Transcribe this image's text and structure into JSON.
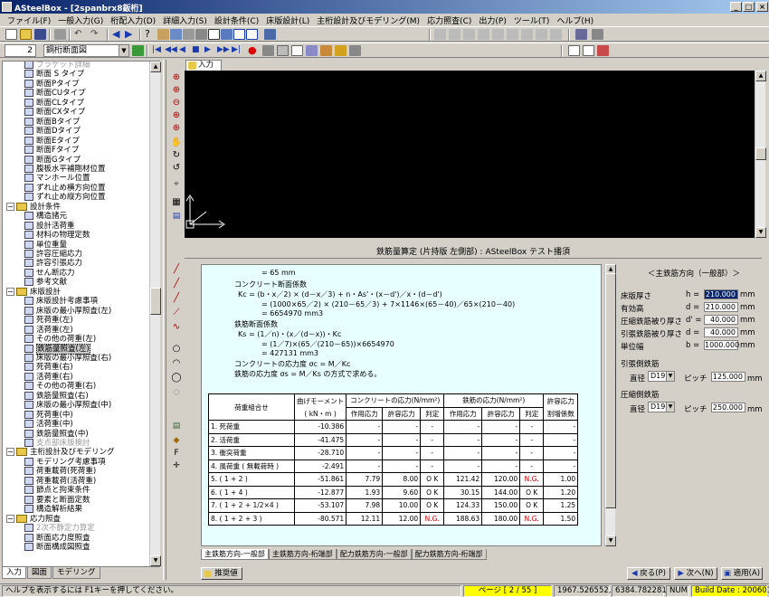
{
  "window": {
    "title": "ASteelBox - [2spanbrx8鈑桁]"
  },
  "menu": [
    "ファイル(F)",
    "一般入力(G)",
    "桁配入力(D)",
    "詳細入力(S)",
    "設計条件(C)",
    "床版設計(L)",
    "主桁設計及びモデリング(M)",
    "応力照査(C)",
    "出力(P)",
    "ツール(T)",
    "ヘルプ(H)"
  ],
  "toolbar2": {
    "number": "2",
    "combo": "鋼桁断面図"
  },
  "tree": [
    {
      "t": "ブラケット詳細",
      "lvl": 2,
      "k": "ic",
      "gray": true
    },
    {
      "t": "断面 S タイプ",
      "lvl": 2,
      "k": "ic"
    },
    {
      "t": "断面Pタイプ",
      "lvl": 2,
      "k": "ic"
    },
    {
      "t": "断面CUタイプ",
      "lvl": 2,
      "k": "ic"
    },
    {
      "t": "断面CLタイプ",
      "lvl": 2,
      "k": "ic"
    },
    {
      "t": "断面CXタイプ",
      "lvl": 2,
      "k": "ic"
    },
    {
      "t": "断面Bタイプ",
      "lvl": 2,
      "k": "ic"
    },
    {
      "t": "断面Dタイプ",
      "lvl": 2,
      "k": "ic"
    },
    {
      "t": "断面Eタイプ",
      "lvl": 2,
      "k": "ic"
    },
    {
      "t": "断面Fタイプ",
      "lvl": 2,
      "k": "ic"
    },
    {
      "t": "断面Gタイプ",
      "lvl": 2,
      "k": "ic"
    },
    {
      "t": "腹板水平補剛材位置",
      "lvl": 2,
      "k": "ic"
    },
    {
      "t": "マンホール位置",
      "lvl": 2,
      "k": "ic"
    },
    {
      "t": "ずれ止め横方向位置",
      "lvl": 2,
      "k": "ic"
    },
    {
      "t": "ずれ止め縦方向位置",
      "lvl": 2,
      "k": "ic"
    },
    {
      "t": "設計条件",
      "lvl": 0,
      "k": "fold"
    },
    {
      "t": "構造諸元",
      "lvl": 1,
      "k": "ic"
    },
    {
      "t": "設計活荷重",
      "lvl": 1,
      "k": "ic"
    },
    {
      "t": "材料の物理定数",
      "lvl": 1,
      "k": "ic"
    },
    {
      "t": "単位重量",
      "lvl": 1,
      "k": "ic"
    },
    {
      "t": "許容圧縮応力",
      "lvl": 1,
      "k": "ic"
    },
    {
      "t": "許容引張応力",
      "lvl": 1,
      "k": "ic"
    },
    {
      "t": "せん断応力",
      "lvl": 1,
      "k": "ic"
    },
    {
      "t": "参考文献",
      "lvl": 1,
      "k": "ic"
    },
    {
      "t": "床版設計",
      "lvl": 0,
      "k": "fold"
    },
    {
      "t": "床版設計考慮事項",
      "lvl": 1,
      "k": "ic"
    },
    {
      "t": "床版の最小厚照査(左)",
      "lvl": 1,
      "k": "ic"
    },
    {
      "t": "死荷重(左)",
      "lvl": 1,
      "k": "ic"
    },
    {
      "t": "活荷重(左)",
      "lvl": 1,
      "k": "ic"
    },
    {
      "t": "その他の荷重(左)",
      "lvl": 1,
      "k": "ic"
    },
    {
      "t": "鉄筋量照査(左)",
      "lvl": 1,
      "k": "ic",
      "sel": true
    },
    {
      "t": "床版の最小厚照査(右)",
      "lvl": 1,
      "k": "ic"
    },
    {
      "t": "死荷重(右)",
      "lvl": 1,
      "k": "ic"
    },
    {
      "t": "活荷重(右)",
      "lvl": 1,
      "k": "ic"
    },
    {
      "t": "その他の荷重(右)",
      "lvl": 1,
      "k": "ic"
    },
    {
      "t": "鉄筋量照査(右)",
      "lvl": 1,
      "k": "ic"
    },
    {
      "t": "床版の最小厚照査(中)",
      "lvl": 1,
      "k": "ic"
    },
    {
      "t": "死荷重(中)",
      "lvl": 1,
      "k": "ic"
    },
    {
      "t": "活荷重(中)",
      "lvl": 1,
      "k": "ic"
    },
    {
      "t": "鉄筋量照査(中)",
      "lvl": 1,
      "k": "ic"
    },
    {
      "t": "支点部床版検討",
      "lvl": 1,
      "k": "ic",
      "gray": true
    },
    {
      "t": "主桁設計及びモデリング",
      "lvl": 0,
      "k": "fold"
    },
    {
      "t": "モデリング考慮事項",
      "lvl": 1,
      "k": "ic"
    },
    {
      "t": "荷重載荷(死荷重)",
      "lvl": 1,
      "k": "ic"
    },
    {
      "t": "荷重載荷(活荷重)",
      "lvl": 1,
      "k": "ic"
    },
    {
      "t": "節点と拘束条件",
      "lvl": 1,
      "k": "ic"
    },
    {
      "t": "要素と断面定数",
      "lvl": 1,
      "k": "ic"
    },
    {
      "t": "構造解析結果",
      "lvl": 1,
      "k": "ic"
    },
    {
      "t": "応力照査",
      "lvl": 0,
      "k": "fold"
    },
    {
      "t": "2次不静定力算定",
      "lvl": 1,
      "k": "ic",
      "gray": true
    },
    {
      "t": "断面応力度照査",
      "lvl": 1,
      "k": "ic"
    },
    {
      "t": "断面構成図照査",
      "lvl": 1,
      "k": "ic"
    }
  ],
  "left_tabs": [
    "入力",
    "図面",
    "モデリング"
  ],
  "canvas_tab": "入力",
  "panel_title": "鉄筋量算定 (片持版 左側部) : ASteelBox テスト播須",
  "calc_lines": [
    "= 65 mm",
    "コンクリート断面係数",
    "Kc      =  (b・x／2) × (d－x／3) + n・As'・(x－d')／x・(d－d')",
    "= (1000×65／2) × (210－65／3) + 7×1146×(65－40)／65×(210－40)",
    "= 6654970 mm3",
    "鉄筋断面係数",
    "Ks      = (1／n)・(x／(d－x))・Kc",
    "= (1／7)×(65／(210－65))×6654970",
    "= 427131 mm3",
    "コンクリートの応力度        σc      =   M／Kc",
    "鉄筋の応力度             σs      =   M／Ks   の方式で求める。"
  ],
  "stress_table": {
    "h_combo": "荷重組合せ",
    "h_moment": "曲げモーメント",
    "h_moment_unit": "( kN・m )",
    "h_conc": "コンクリートの応力(N/mm²)",
    "h_steel": "鉄筋の応力(N/mm²)",
    "h_allow": "許容応力",
    "h_actual": "作用応力",
    "h_allowable": "許容応力",
    "h_judge": "判定",
    "h_increase": "割増係数",
    "rows": [
      [
        "1.  死荷重",
        "-10.386",
        "-",
        "-",
        "-",
        "-",
        "-",
        "-",
        "-"
      ],
      [
        "2.  活荷重",
        "-41.475",
        "-",
        "-",
        "-",
        "-",
        "-",
        "-",
        "-"
      ],
      [
        "3.  衝突荷重",
        "-28.710",
        "-",
        "-",
        "-",
        "-",
        "-",
        "-",
        "-"
      ],
      [
        "4.  風荷重 ( 無載荷時 )",
        "-2.491",
        "-",
        "-",
        "-",
        "-",
        "-",
        "-",
        "-"
      ],
      [
        "5.  ( 1 + 2 )",
        "-51.861",
        "7.79",
        "8.00",
        "O K",
        "121.42",
        "120.00",
        "N.G.",
        "1.00"
      ],
      [
        "6.  ( 1 + 4 )",
        "-12.877",
        "1.93",
        "9.60",
        "O K",
        "30.15",
        "144.00",
        "O K",
        "1.20"
      ],
      [
        "7.  ( 1 + 2 + 1/2×4 )",
        "-53.107",
        "7.98",
        "10.00",
        "O K",
        "124.33",
        "150.00",
        "O K",
        "1.25"
      ],
      [
        "8.  ( 1 + 2 + 3 )",
        "-80.571",
        "12.11",
        "12.00",
        "N.G.",
        "188.63",
        "180.00",
        "N.G.",
        "1.50"
      ]
    ]
  },
  "right_panel": {
    "heading": "＜主鉄筋方向（一般部）＞",
    "fields": [
      {
        "label": "床版厚さ",
        "sym": "h =",
        "value": "210.000",
        "unit": "mm"
      },
      {
        "label": "有効高",
        "sym": "d =",
        "value": "210.000",
        "unit": "mm"
      },
      {
        "label": "圧縮鉄筋被り厚さ",
        "sym": "d' =",
        "value": "40.000",
        "unit": "mm"
      },
      {
        "label": "引張鉄筋被り厚さ",
        "sym": "d =",
        "value": "40.000",
        "unit": "mm"
      },
      {
        "label": "単位幅",
        "sym": "b =",
        "value": "1000.000",
        "unit": "mm"
      }
    ],
    "tension_label": "引張側鉄筋",
    "compress_label": "圧縮側鉄筋",
    "dia_label": "直径",
    "pitch_label": "ピッチ",
    "tension": {
      "dia": "D19",
      "pitch": "125.000",
      "unit": "mm"
    },
    "compress": {
      "dia": "D19",
      "pitch": "250.000",
      "unit": "mm"
    }
  },
  "bottom_tabs": [
    "主鉄筋方向-一般部",
    "主鉄筋方向-桁端部",
    "配力鉄筋方向-一般部",
    "配力鉄筋方向-桁端部"
  ],
  "buttons": {
    "remarks": "推奨値",
    "back": "戻る(P)",
    "next": "次へ(N)",
    "apply": "適用(A)"
  },
  "status": {
    "help": "ヘルプを表示するには F1キーを押してください。",
    "page": "ページ [ 2 / 55 ]",
    "coord1": "1967.526552,",
    "coord2": "6384.782281",
    "num": "NUM",
    "build": "Build Date : 20060110"
  }
}
